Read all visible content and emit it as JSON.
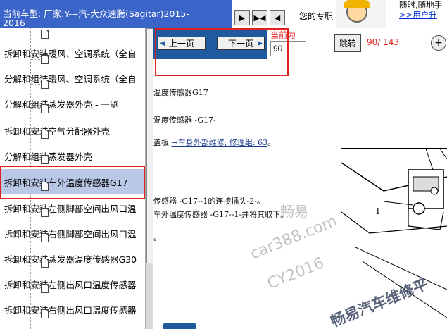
{
  "header": {
    "model_line1": "当前车型:  厂家:Y---汽-大众速腾(Sagitar)2015-",
    "model_line2": "2016",
    "your_text": "您的专职",
    "promo_line1": "随时,随地手",
    "promo_link": ">>用户升"
  },
  "tree": {
    "items": [
      {
        "label": "拆卸和安装暖风、空调系统（全自"
      },
      {
        "label": "分解和组装暖风、空调系统（全自"
      },
      {
        "label": "分解和组装蒸发器外壳 - 一览"
      },
      {
        "label": "拆卸和安装空气分配器外壳"
      },
      {
        "label": "分解和组装蒸发器外壳"
      },
      {
        "label": "拆卸和安装车外温度传感器G17"
      },
      {
        "label": "拆卸和安装左侧脚部空间出风口温"
      },
      {
        "label": "拆卸和安装右侧脚部空间出风口温"
      },
      {
        "label": "拆卸和安装蒸发器温度传感器G30"
      },
      {
        "label": "拆卸和安装左侧出风口温度传感器"
      },
      {
        "label": "拆卸和安装右侧出风口温度传感器"
      }
    ]
  },
  "nav": {
    "prev_label": "上一页",
    "next_label": "下一页",
    "current_label": "当前为",
    "page_value": "90",
    "go_label": "跳转",
    "page_count": "90/ 143",
    "zoom_label": "+"
  },
  "doc": {
    "line1": "温度传感器G17",
    "line2": "温度传感器 -G17-",
    "line3_prefix": "盖板 ",
    "line3_link": "→车身外部维修; 修理组: 63",
    "line3_suffix": "。",
    "line4": "传感器 -G17--1的连接插头-2-。",
    "line5": "车外温度传感器 -G17--1-并将其取下。",
    "line6": "。",
    "callout": "1"
  },
  "watermark": {
    "line1": "畅易",
    "line2": "car388.com",
    "line3": "CY2016",
    "line4": "畅易汽车维修平"
  }
}
